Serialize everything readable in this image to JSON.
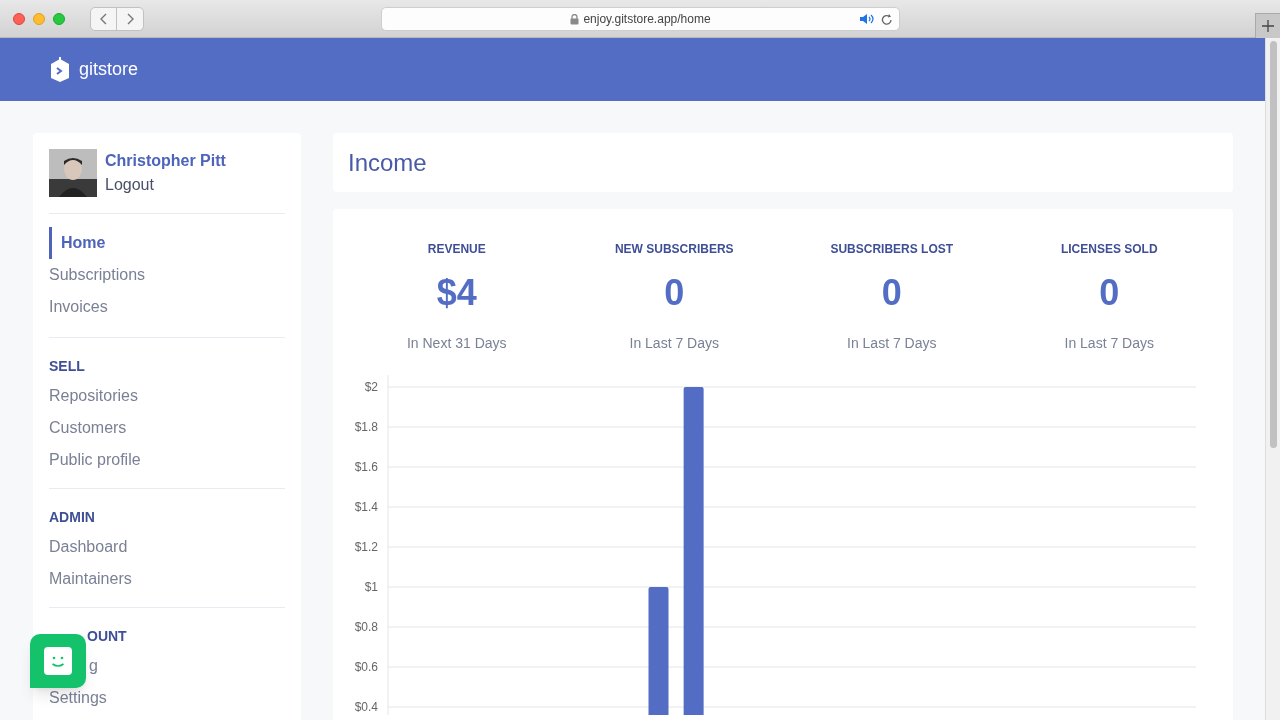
{
  "browser": {
    "url": "enjoy.gitstore.app/home"
  },
  "app": {
    "brand": "gitstore"
  },
  "user": {
    "name": "Christopher Pitt",
    "action": "Logout"
  },
  "nav": [
    {
      "label": "Home",
      "selected": true
    },
    {
      "label": "Subscriptions",
      "selected": false
    },
    {
      "label": "Invoices",
      "selected": false
    }
  ],
  "sections": [
    {
      "title": "SELL",
      "items": [
        {
          "label": "Repositories"
        },
        {
          "label": "Customers"
        },
        {
          "label": "Public profile"
        }
      ]
    },
    {
      "title": "ADMIN",
      "items": [
        {
          "label": "Dashboard"
        },
        {
          "label": "Maintainers"
        }
      ]
    },
    {
      "title": "OUNT",
      "partly_hidden": true,
      "items": [
        {
          "label": "g",
          "partly_hidden": true
        },
        {
          "label": "Settings"
        }
      ]
    }
  ],
  "page": {
    "title": "Income"
  },
  "stats": [
    {
      "label": "REVENUE",
      "value": "$4",
      "caption": "In Next 31 Days"
    },
    {
      "label": "NEW SUBSCRIBERS",
      "value": "0",
      "caption": "In Last 7 Days"
    },
    {
      "label": "SUBSCRIBERS LOST",
      "value": "0",
      "caption": "In Last 7 Days"
    },
    {
      "label": "LICENSES SOLD",
      "value": "0",
      "caption": "In Last 7 Days"
    }
  ],
  "chart_data": {
    "type": "bar",
    "grid": true,
    "ylim": [
      0,
      2
    ],
    "values": [
      0,
      0,
      0,
      0,
      0,
      0,
      0,
      1,
      2,
      0,
      0,
      0,
      0,
      0,
      0,
      0,
      0,
      0,
      0,
      0,
      0,
      0,
      0
    ],
    "yticks": [
      {
        "value": 0.4,
        "label": "$0.4"
      },
      {
        "value": 0.6,
        "label": "$0.6"
      },
      {
        "value": 0.8,
        "label": "$0.8"
      },
      {
        "value": 1,
        "label": "$1"
      },
      {
        "value": 1.2,
        "label": "$1.2"
      },
      {
        "value": 1.4,
        "label": "$1.4"
      },
      {
        "value": 1.6,
        "label": "$1.6"
      },
      {
        "value": 1.8,
        "label": "$1.8"
      },
      {
        "value": 2,
        "label": "$2"
      }
    ]
  }
}
